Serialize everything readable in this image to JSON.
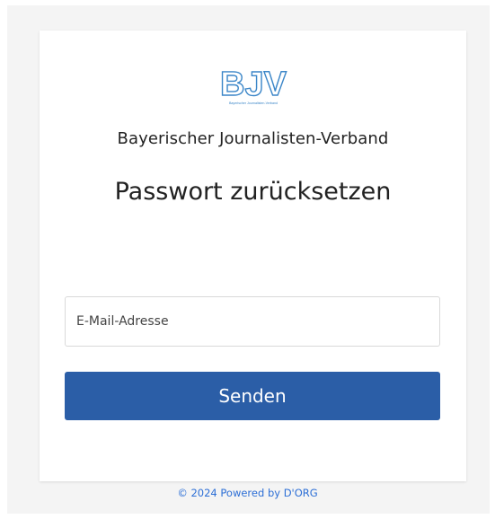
{
  "brand": {
    "logo_text": "BJV",
    "logo_subtext": "Bayerischer Journalisten-Verband",
    "org_name": "Bayerischer Journalisten-Verband"
  },
  "form": {
    "title": "Passwort zurücksetzen",
    "email_placeholder": "E-Mail-Adresse",
    "email_value": "",
    "submit_label": "Senden"
  },
  "footer": {
    "text": "© 2024 Powered by D'ORG"
  },
  "colors": {
    "primary_button": "#2b5ea7",
    "logo_blue": "#3b86c8",
    "link_blue": "#2d6fd6"
  }
}
